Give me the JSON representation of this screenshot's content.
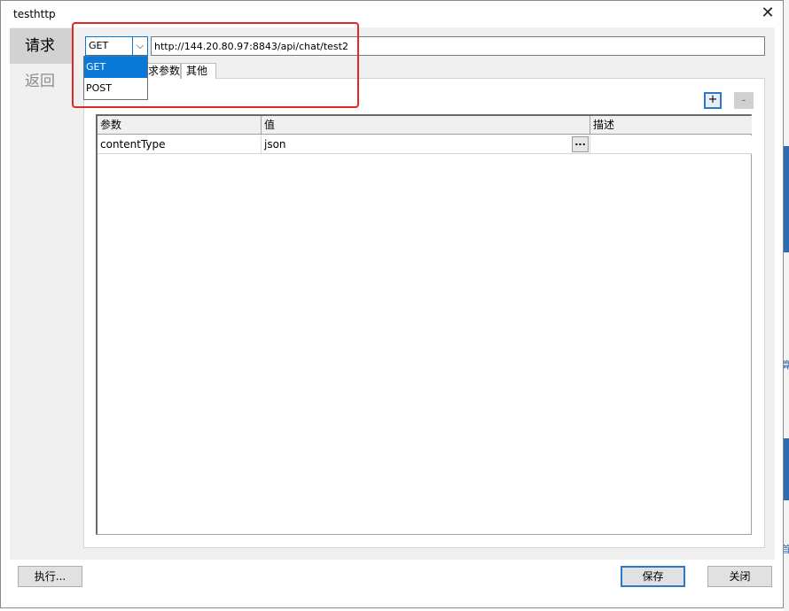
{
  "window": {
    "title": "testhttp",
    "close_glyph": "✕"
  },
  "nav": {
    "items": [
      {
        "label": "请求",
        "active": true
      },
      {
        "label": "返回",
        "active": false
      }
    ]
  },
  "request": {
    "method": "GET",
    "method_options": [
      "GET",
      "POST"
    ],
    "url": "http://144.20.80.97:8843/api/chat/test2",
    "tabs": [
      {
        "label": "求参数",
        "partially_hidden": true
      },
      {
        "label": "其他"
      }
    ],
    "add_label": "+",
    "remove_label": "-",
    "dropdown_arrow": "⌵"
  },
  "params_table": {
    "columns": [
      "参数",
      "值",
      "描述"
    ],
    "rows": [
      {
        "param": "contentType",
        "value": "json",
        "desc": ""
      }
    ],
    "ellipsis_label": "..."
  },
  "footer": {
    "execute_label": "执行...",
    "save_label": "保存",
    "close_label": "关闭"
  },
  "edge_glyphs": [
    "算",
    "首"
  ],
  "colors": {
    "highlight": "#e22727",
    "accent": "#0a78d7",
    "panel_bg": "#f0f0f0"
  }
}
